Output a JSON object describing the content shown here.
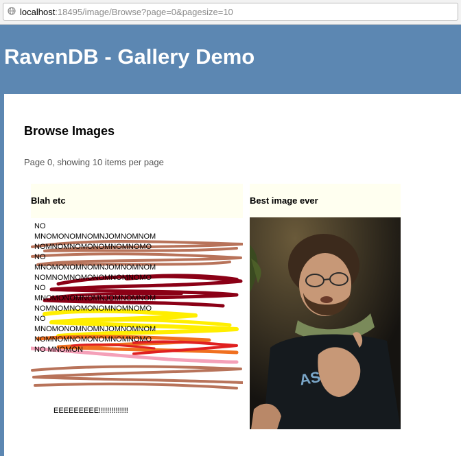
{
  "browser": {
    "url_host": "localhost",
    "url_rest": ":18495/image/Browse?page=0&pagesize=10"
  },
  "header": {
    "title": "RavenDB - Gallery Demo"
  },
  "main": {
    "heading": "Browse Images",
    "page_info": "Page 0, showing 10 items per page"
  },
  "images": [
    {
      "title": "Blah etc",
      "lines": [
        "NO",
        "MNOMONOMNOMNJOMNOMNOM",
        "NOMNOMNOMONOMNOMNOMO",
        "NO",
        "MNOMONOMNOMNJOMNOMNOM",
        "NOMNOMNOMONOMNOMNOMO",
        "NO",
        "MNOMONOMNOMNJOMNOMNOM",
        "NOMNOMNOMONOMNOMNOMO",
        "NO",
        "MNOMONOMNOMNJOMNOMNOM",
        "NOMNOMNOMONOMNOMNOMO",
        "NO MNOMON"
      ],
      "footer": "EEEEEEEEE!!!!!!!!!!!!!!"
    },
    {
      "title": "Best image ever",
      "icon": "photo-person-gesturing"
    }
  ],
  "colors": {
    "header_bg": "#5c87b2",
    "card_bg": "#fffff0",
    "scribble_brown": "#b8735a",
    "scribble_darkred": "#8b0016",
    "scribble_yellow": "#ffee00",
    "scribble_orange": "#f07020",
    "scribble_red": "#e02020",
    "scribble_pink": "#f4a0b8"
  }
}
